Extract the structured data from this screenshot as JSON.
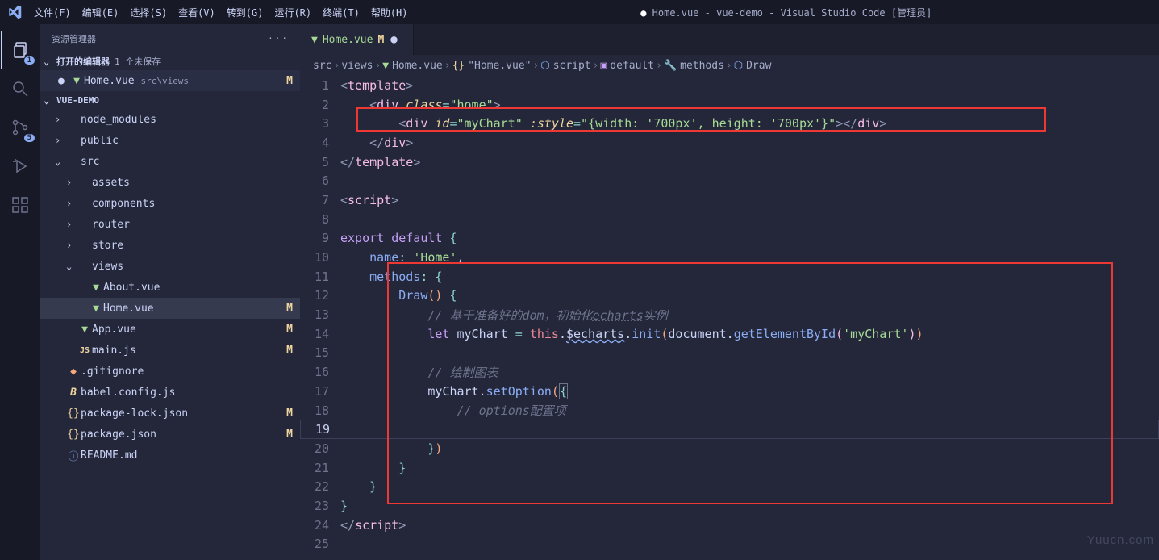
{
  "titlebar": {
    "menus": [
      "文件(F)",
      "编辑(E)",
      "选择(S)",
      "查看(V)",
      "转到(G)",
      "运行(R)",
      "终端(T)",
      "帮助(H)"
    ],
    "title_prefix": "● ",
    "title": "Home.vue - vue-demo - Visual Studio Code [管理员]"
  },
  "activitybar": {
    "badges": {
      "explorer": "1",
      "scm": "5"
    }
  },
  "explorer": {
    "title": "资源管理器",
    "open_editors_label": "打开的编辑器",
    "unsaved_label": "1 个未保存",
    "open_editors": [
      {
        "name": "Home.vue",
        "path": "src\\views",
        "status": "M",
        "dirty": true
      }
    ],
    "project": "VUE-DEMO",
    "tree": [
      {
        "indent": 1,
        "chev": ">",
        "icon": "folder",
        "name": "node_modules"
      },
      {
        "indent": 1,
        "chev": ">",
        "icon": "folder",
        "name": "public"
      },
      {
        "indent": 1,
        "chev": "v",
        "icon": "folder",
        "name": "src"
      },
      {
        "indent": 2,
        "chev": ">",
        "icon": "folder",
        "name": "assets"
      },
      {
        "indent": 2,
        "chev": ">",
        "icon": "folder",
        "name": "components"
      },
      {
        "indent": 2,
        "chev": ">",
        "icon": "folder",
        "name": "router"
      },
      {
        "indent": 2,
        "chev": ">",
        "icon": "folder",
        "name": "store"
      },
      {
        "indent": 2,
        "chev": "v",
        "icon": "folder",
        "name": "views"
      },
      {
        "indent": 3,
        "icon": "vue",
        "name": "About.vue"
      },
      {
        "indent": 3,
        "icon": "vue",
        "name": "Home.vue",
        "status": "M",
        "selected": true
      },
      {
        "indent": 2,
        "icon": "vue",
        "name": "App.vue",
        "status": "M"
      },
      {
        "indent": 2,
        "icon": "js",
        "name": "main.js",
        "status": "M"
      },
      {
        "indent": 1,
        "icon": "git",
        "name": ".gitignore"
      },
      {
        "indent": 1,
        "icon": "babel",
        "name": "babel.config.js"
      },
      {
        "indent": 1,
        "icon": "json",
        "name": "package-lock.json",
        "status": "M"
      },
      {
        "indent": 1,
        "icon": "json",
        "name": "package.json",
        "status": "M"
      },
      {
        "indent": 1,
        "icon": "info",
        "name": "README.md"
      }
    ]
  },
  "tab": {
    "filename": "Home.vue",
    "mod": "M"
  },
  "breadcrumbs": [
    {
      "icon": "",
      "label": "src"
    },
    {
      "icon": "",
      "label": "views"
    },
    {
      "icon": "vue",
      "label": "Home.vue"
    },
    {
      "icon": "braces",
      "label": "\"Home.vue\""
    },
    {
      "icon": "cube",
      "label": "script"
    },
    {
      "icon": "box",
      "label": "default"
    },
    {
      "icon": "wrench",
      "label": "methods"
    },
    {
      "icon": "cube",
      "label": "Draw"
    }
  ],
  "code": {
    "active_line": 19,
    "lines_count": 25,
    "comments": {
      "c1": "// 基于准备好的dom，初始化echarts实例",
      "c2": "// 绘制图表",
      "c3": "// options配置项"
    },
    "strings": {
      "home": "\"home\"",
      "myChart": "\"myChart\"",
      "styleval": "\"{width: '700px', height: '700px'}\"",
      "homename": "'Home'",
      "mychartarg": "'myChart'"
    }
  },
  "watermark": "Yuucn.com"
}
